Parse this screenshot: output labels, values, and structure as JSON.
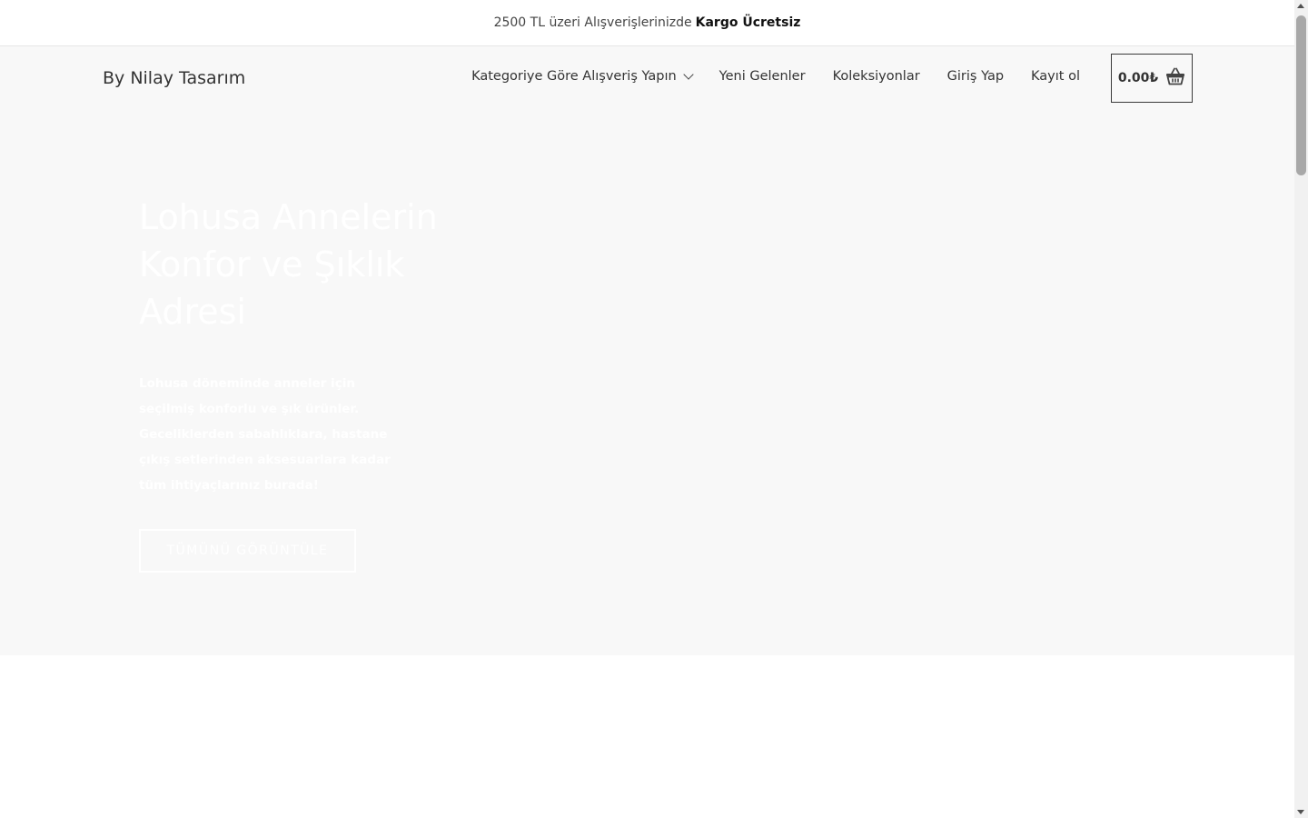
{
  "promo": {
    "text": "2500 TL üzeri Alışverişlerinizde",
    "highlight": "Kargo Ücretsiz"
  },
  "header": {
    "logo": "By Nilay Tasarım",
    "nav": [
      {
        "label": "Kategoriye Göre Alışveriş Yapın"
      },
      {
        "label": "Yeni Gelenler"
      },
      {
        "label": "Koleksiyonlar"
      },
      {
        "label": "Giriş Yap"
      },
      {
        "label": "Kayıt ol"
      }
    ],
    "cart_total": "0.00₺"
  },
  "hero": {
    "title": "Lohusa Annelerin Konfor ve Şıklık Adresi",
    "text": "Lohusa döneminde anneler için seçilmiş konforlu ve şık ürünler. Geceliklerden sabahlıklara, hastane çıkış setlerinden aksesuarlara kadar tüm ihtiyaçlarınız burada!",
    "button_label": "TÜMÜNÜ GÖRÜNTÜLE"
  },
  "icons": {
    "cart": "basket-icon",
    "dropdown": "chevron-down-icon"
  },
  "colors": {
    "header_bg": "#f8f8f8",
    "text": "#333333",
    "hero_text": "#ffffff"
  }
}
